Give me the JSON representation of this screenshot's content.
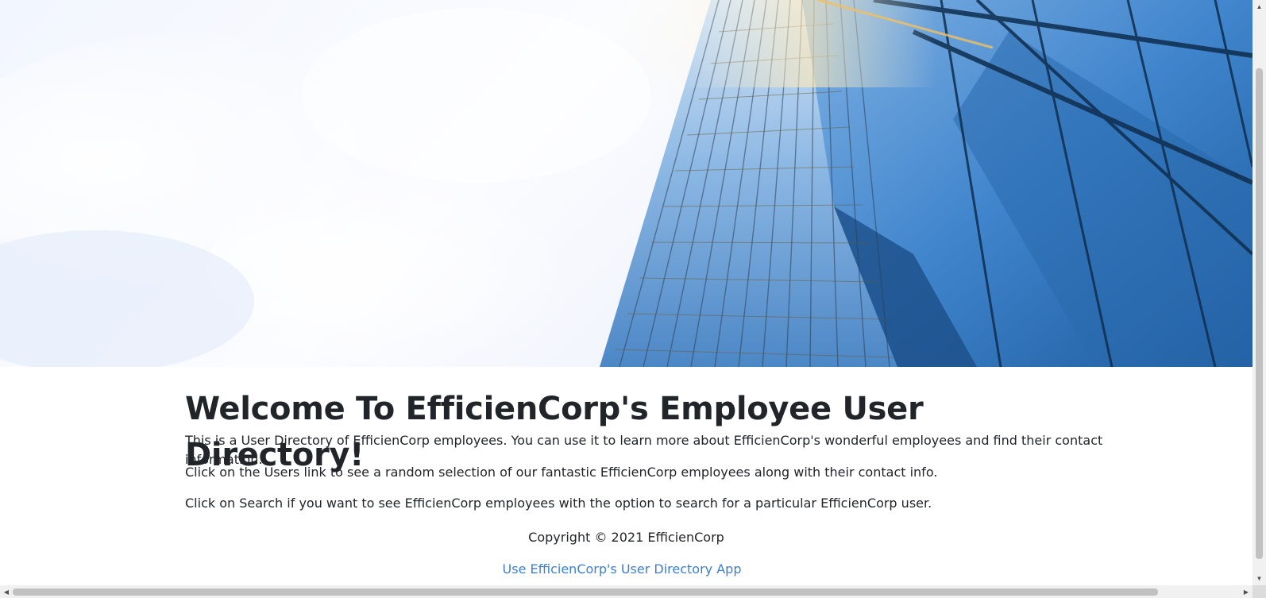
{
  "hero": {
    "image": "glass-skyscraper-against-sky-illustration"
  },
  "main": {
    "title": "Welcome To EfficienCorp's Employee User Directory!",
    "paragraphs": [
      "This is a User Directory of EfficienCorp employees. You can use it to learn more about EfficienCorp's wonderful employees and find their contact information.",
      "Click on the Users link to see a random selection of our fantastic EfficienCorp employees along with their contact info.",
      "Click on Search if you want to see EfficienCorp employees with the option to search for a particular EfficienCorp user."
    ]
  },
  "footer": {
    "copyright": "Copyright © 2021 EfficienCorp",
    "app_link": "Use EfficienCorp's User Directory App"
  },
  "scrollbars": {
    "up_icon": "▲",
    "down_icon": "▼",
    "left_icon": "◀",
    "right_icon": "▶"
  },
  "colors": {
    "link": "#3d7fcf",
    "text": "#212529",
    "glass_blue": "#2f6fb6"
  }
}
